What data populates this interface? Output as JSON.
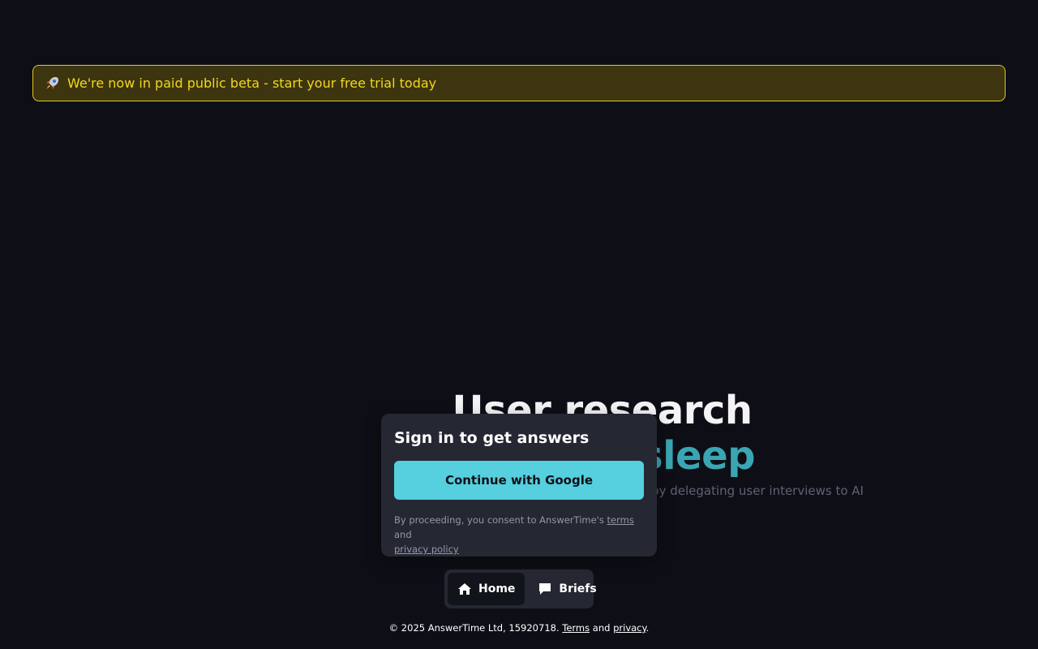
{
  "banner": {
    "icon": "rocket-icon",
    "text": "We're now in paid public beta - start your free trial today",
    "border_color": "#e3c81a",
    "text_color": "#f1d71f"
  },
  "hero": {
    "title_line1": "User research",
    "title_line2": "sleep",
    "subtitle": "ts by delegating user interviews to AI",
    "accent_color": "#3aa6b4"
  },
  "modal": {
    "title": "Sign in to get answers",
    "google_button_label": "Continue with Google",
    "consent_prefix": "By proceeding, you consent to AnswerTime's ",
    "terms_link": "terms",
    "consent_and": " and",
    "privacy_link": "privacy policy",
    "button_color": "#56cfdf"
  },
  "nav": {
    "items": [
      {
        "label": "Home",
        "icon": "home-icon",
        "active": true
      },
      {
        "label": "Briefs",
        "icon": "chat-bubble-icon",
        "active": false
      }
    ]
  },
  "footer": {
    "prefix": "© 2025 AnswerTime Ltd, 15920718. ",
    "terms_link": "Terms",
    "and": " and ",
    "privacy_link": "privacy",
    "suffix": "."
  }
}
